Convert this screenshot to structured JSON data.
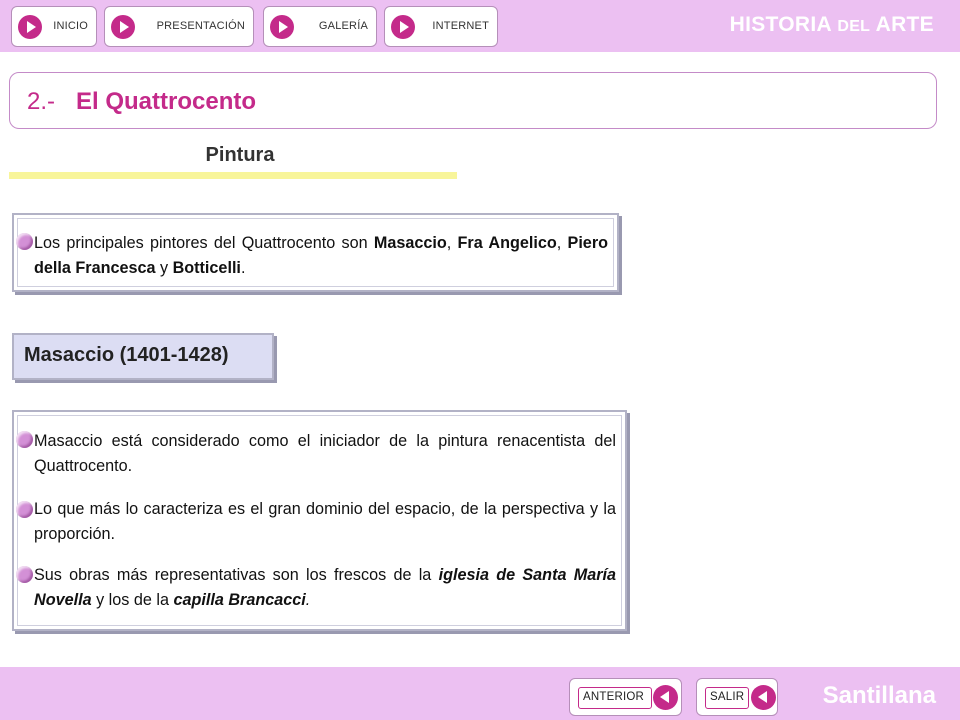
{
  "nav": {
    "inicio": "INICIO",
    "presentacion": "PRESENTACIÓN",
    "galeria": "GALERÍA",
    "internet": "INTERNET"
  },
  "brand": {
    "historia": "HISTORIA",
    "del": "DEL",
    "arte": "ARTE",
    "publisher": "Santillana"
  },
  "title": {
    "number": "2.-",
    "text": "El Quattrocento"
  },
  "section": {
    "heading": "Pintura"
  },
  "intro": {
    "t1": "Los principales pintores del Quattrocento son ",
    "n1": "Masaccio",
    "t2": ", ",
    "n2": "Fra Angelico",
    "t3": ", ",
    "n3": "Piero della Francesca",
    "t4": " y ",
    "n4": "Botticelli",
    "t5": "."
  },
  "artist": {
    "name": "Masaccio (1401-1428)"
  },
  "points": {
    "p1": "Masaccio está considerado como el iniciador de la pintura renacentista del Quattrocento.",
    "p2": "Lo que más lo caracteriza es el gran dominio del espacio, de la perspectiva y la proporción.",
    "p3a": "Sus obras más representativas son los frescos de la ",
    "p3b": "iglesia de Santa María Novella",
    "p3c": " y los de la ",
    "p3d": "capilla Brancacci",
    "p3e": "."
  },
  "footer": {
    "anterior": "ANTERIOR",
    "salir": "SALIR"
  },
  "icons": {
    "nav_arrow": "play-arrow-icon",
    "bullet": "bullet-icon",
    "back": "back-arrow-icon"
  },
  "colors": {
    "bar": "#ecc0f2",
    "accent": "#c42a8a",
    "bullet": "#d390d6",
    "highlight": "#f8f59a",
    "namebox": "#dcddf3"
  }
}
